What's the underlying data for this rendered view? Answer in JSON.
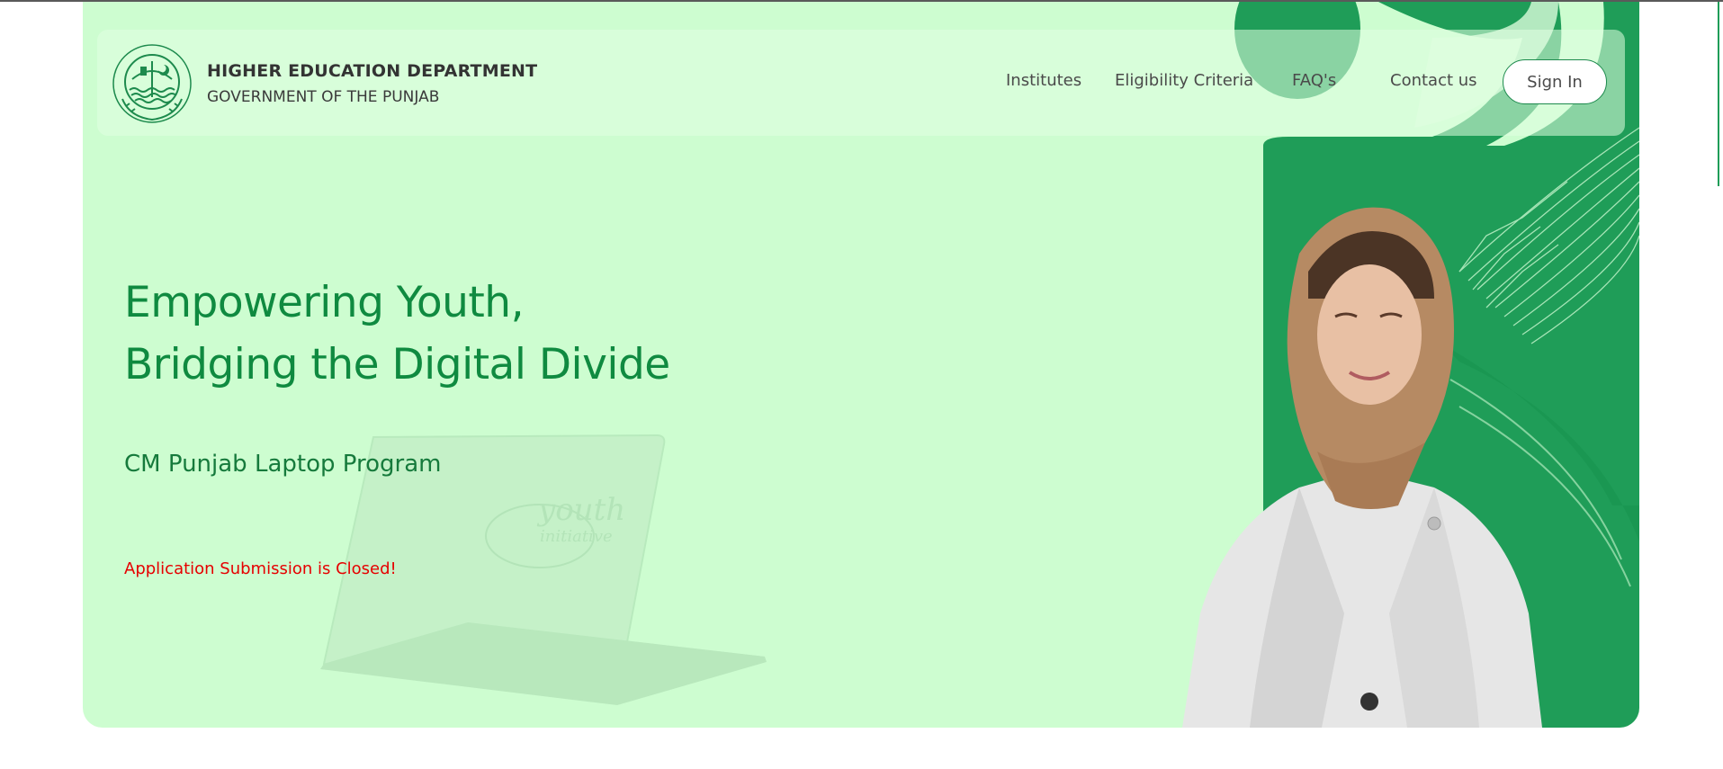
{
  "header": {
    "brand_title": "HIGHER EDUCATION DEPARTMENT",
    "brand_subtitle": "GOVERNMENT OF THE PUNJAB",
    "logo_ring_text": "Higher Education Department"
  },
  "nav": {
    "items": [
      {
        "label": "Institutes"
      },
      {
        "label": "Eligibility Criteria"
      },
      {
        "label": "FAQ's"
      },
      {
        "label": "Contact us"
      }
    ],
    "signin_label": "Sign In"
  },
  "hero": {
    "headline_line1": "Empowering Youth,",
    "headline_line2": "Bridging the Digital Divide",
    "program": "CM Punjab Laptop Program",
    "status": "Application Submission is Closed!",
    "laptop_screen_text": "youth initiative"
  },
  "colors": {
    "hero_bg": "#cdfdd0",
    "brand_green": "#0f8a40",
    "deco_green": "#1f9d58",
    "status_red": "#e60000"
  }
}
